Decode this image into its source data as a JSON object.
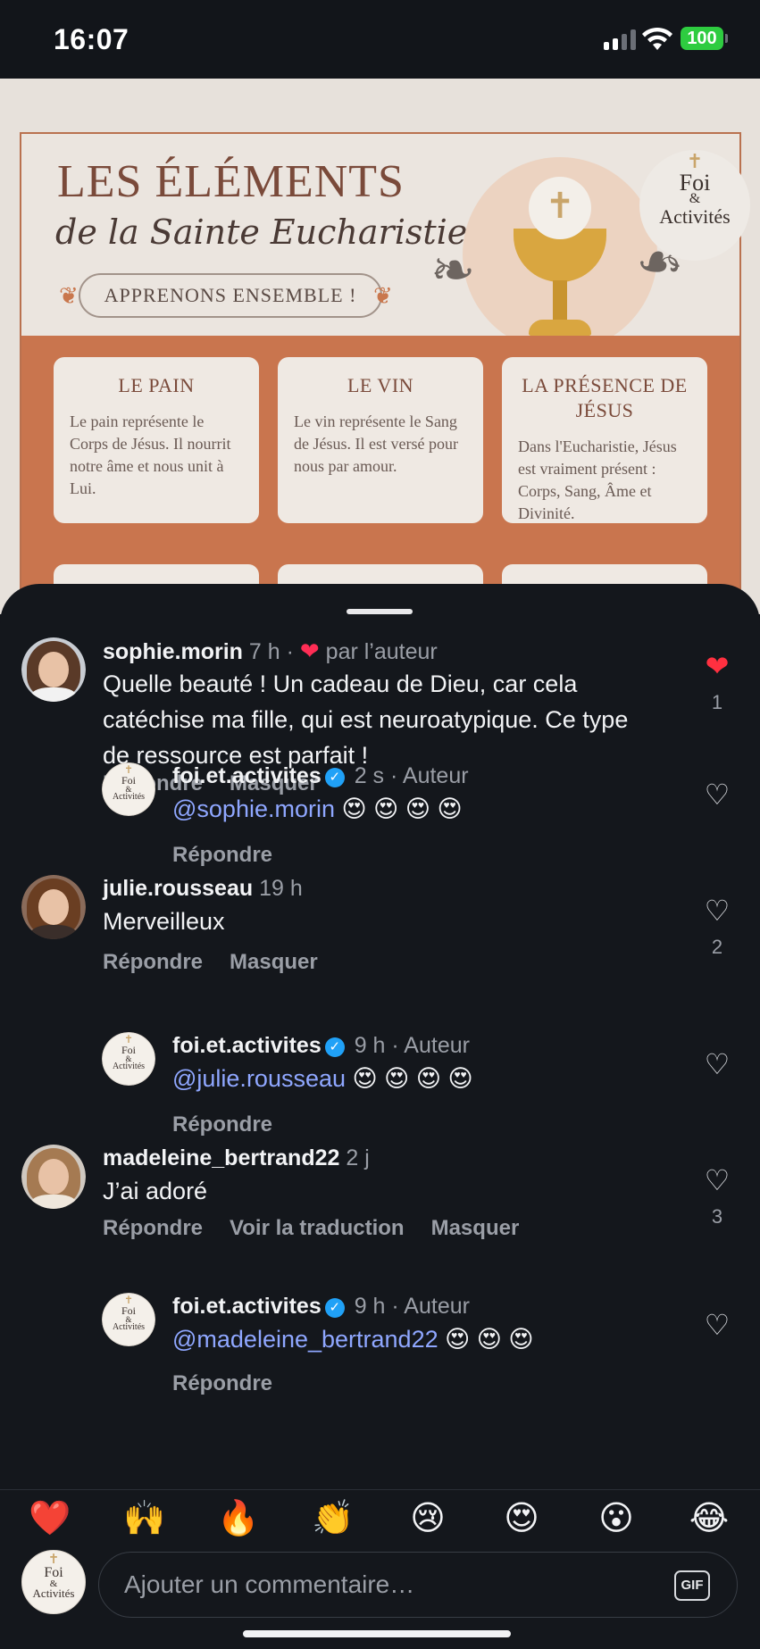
{
  "status_bar": {
    "time": "16:07",
    "battery": "100"
  },
  "poster": {
    "title": "LES ÉLÉMENTS",
    "subtitle": "de la Sainte Eucharistie",
    "pill": "APPRENONS ENSEMBLE !",
    "logo": {
      "line1": "Foi",
      "line2": "&",
      "line3": "Activités"
    },
    "cards": [
      {
        "title": "LE PAIN",
        "text": "Le pain représente le Corps de Jésus. Il nourrit notre âme et nous unit à Lui."
      },
      {
        "title": "LE VIN",
        "text": "Le vin représente le Sang de Jésus. Il est versé pour nous par amour."
      },
      {
        "title": "LA PRÉSENCE DE JÉSUS",
        "text": "Dans l'Eucharistie, Jésus est vraiment présent : Corps, Sang, Âme et Divinité."
      }
    ]
  },
  "comments": [
    {
      "user": "sophie.morin",
      "time": "7 h",
      "liked_by_author": "par l’auteur",
      "text": "Quelle beauté ! Un cadeau de Dieu, car cela catéchise ma fille, qui est neuroatypique. Ce type de ressource est parfait !",
      "actions": [
        "Répondre",
        "Masquer"
      ],
      "likes": "1",
      "liked": true,
      "reply": {
        "user": "foi.et.activites",
        "time": "2 s",
        "author": "Auteur",
        "mention": "@sophie.morin",
        "emojis": "😍 😍 😍 😍",
        "action": "Répondre"
      }
    },
    {
      "user": "julie.rousseau",
      "time": "19 h",
      "text": "Merveilleux",
      "actions": [
        "Répondre",
        "Masquer"
      ],
      "likes": "2",
      "liked": false,
      "reply": {
        "user": "foi.et.activites",
        "time": "9 h",
        "author": "Auteur",
        "mention": "@julie.rousseau",
        "emojis": "😍 😍 😍 😍",
        "action": "Répondre"
      }
    },
    {
      "user": "madeleine_bertrand22",
      "time": "2 j",
      "text": "J’ai adoré",
      "actions": [
        "Répondre",
        "Voir la traduction",
        "Masquer"
      ],
      "likes": "3",
      "liked": false,
      "reply": {
        "user": "foi.et.activites",
        "time": "9 h",
        "author": "Auteur",
        "mention": "@madeleine_bertrand22",
        "emojis": "😍 😍 😍",
        "action": "Répondre"
      }
    }
  ],
  "emoji_bar": [
    "❤️",
    "🙌",
    "🔥",
    "👏",
    "😢",
    "😍",
    "😮",
    "😂"
  ],
  "composer": {
    "placeholder": "Ajouter un commentaire…",
    "gif": "GIF"
  },
  "icons": {
    "verified": "verified-badge-icon",
    "heart": "heart-icon",
    "gif": "gif-icon"
  },
  "colors": {
    "accent_heart": "#ff3040",
    "mention": "#8fa7ff",
    "verified": "#20a1f7"
  }
}
